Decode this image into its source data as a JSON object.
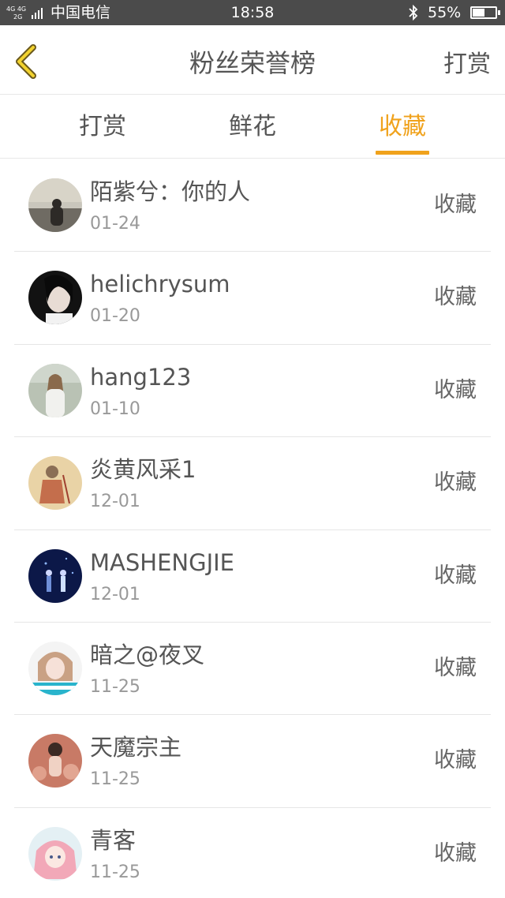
{
  "status_bar": {
    "network_top": "4G 4G",
    "network_bottom": "2G",
    "carrier": "中国电信",
    "time": "18:58",
    "battery_text": "55%",
    "battery_level": 0.55
  },
  "header": {
    "title": "粉丝荣誉榜",
    "action_label": "打赏",
    "back_icon": "chevron-left-icon",
    "accent": "#f0a21c"
  },
  "tabs": [
    {
      "label": "打赏",
      "active": false
    },
    {
      "label": "鲜花",
      "active": false
    },
    {
      "label": "收藏",
      "active": true
    }
  ],
  "fans": [
    {
      "name": "陌紫兮：你的人",
      "date": "01-24",
      "status": "收藏"
    },
    {
      "name": "helichrysum",
      "date": "01-20",
      "status": "收藏"
    },
    {
      "name": "hang123",
      "date": "01-10",
      "status": "收藏"
    },
    {
      "name": "炎黄风采1",
      "date": "12-01",
      "status": "收藏"
    },
    {
      "name": "MASHENGJIE",
      "date": "12-01",
      "status": "收藏"
    },
    {
      "name": "暗之@夜叉",
      "date": "11-25",
      "status": "收藏"
    },
    {
      "name": "天魔宗主",
      "date": "11-25",
      "status": "收藏"
    },
    {
      "name": "青客",
      "date": "11-25",
      "status": "收藏"
    }
  ]
}
